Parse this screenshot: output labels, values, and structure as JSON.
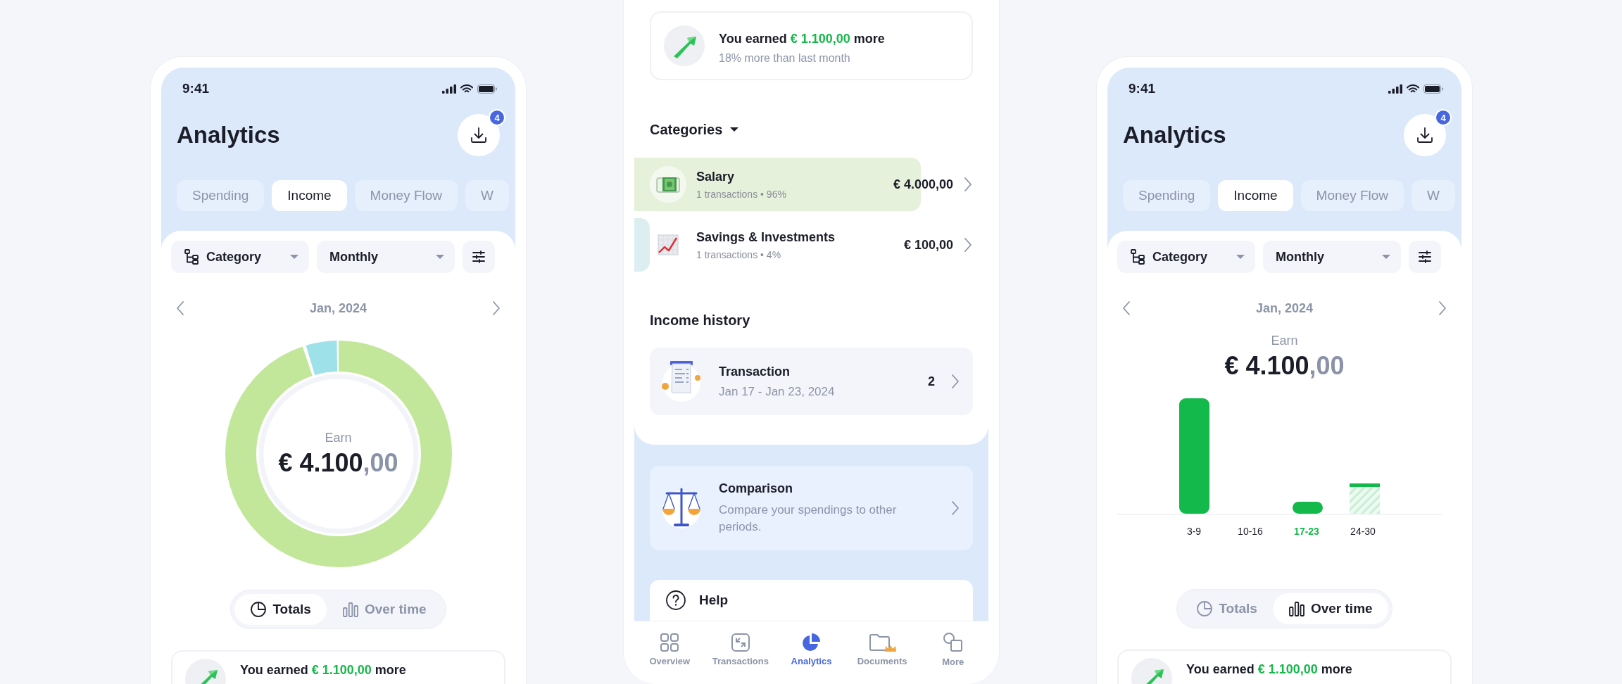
{
  "screens": [
    {
      "kind": "totals",
      "status_bar": {
        "time": "9:41"
      },
      "title": "Analytics",
      "download_badge": "4",
      "tabs": [
        {
          "label": "Spending",
          "selected": false
        },
        {
          "label": "Income",
          "selected": true
        },
        {
          "label": "Money Flow",
          "selected": false
        },
        {
          "label": "W",
          "selected": false
        }
      ],
      "filters": {
        "group_by": "Category",
        "period": "Monthly"
      },
      "period": "Jan, 2024",
      "total": {
        "label": "Earn",
        "whole": "€ 4.100",
        "cents": ",00"
      },
      "view_toggle": [
        {
          "label": "Totals",
          "selected": true
        },
        {
          "label": "Over time",
          "selected": false
        }
      ],
      "insight": {
        "prefix": "You earned",
        "amount": "€ 1.100,00",
        "suffix": "more"
      }
    },
    {
      "kind": "details",
      "insight": {
        "prefix": "You earned",
        "amount": "€ 1.100,00",
        "suffix": "more",
        "subtitle": "18% more than last month"
      },
      "categories_title": "Categories",
      "categories": [
        {
          "name": "Salary",
          "meta": "1 transactions • 96%",
          "amount": "€ 4.000,00",
          "level": 0.81,
          "color": "#e6f1dc"
        },
        {
          "name": "Savings & Investments",
          "meta": "1 transactions • 4%",
          "amount": "€ 100,00",
          "level": 0.044,
          "color": "#ddeef1"
        }
      ],
      "history_title": "Income history",
      "history": [
        {
          "title": "Transaction",
          "dates": "Jan 17 - Jan 23, 2024",
          "count": "2"
        }
      ],
      "comparison": {
        "title": "Comparison",
        "text": "Compare your spendings to other periods."
      },
      "help": {
        "label": "Help"
      },
      "nav": [
        {
          "label": "Overview",
          "selected": false
        },
        {
          "label": "Transactions",
          "selected": false
        },
        {
          "label": "Analytics",
          "selected": true
        },
        {
          "label": "Documents",
          "selected": false
        },
        {
          "label": "More",
          "selected": false
        }
      ]
    },
    {
      "kind": "over_time",
      "status_bar": {
        "time": "9:41"
      },
      "title": "Analytics",
      "download_badge": "4",
      "tabs": [
        {
          "label": "Spending",
          "selected": false
        },
        {
          "label": "Income",
          "selected": true
        },
        {
          "label": "Money Flow",
          "selected": false
        },
        {
          "label": "W",
          "selected": false
        }
      ],
      "filters": {
        "group_by": "Category",
        "period": "Monthly"
      },
      "period": "Jan, 2024",
      "total": {
        "label": "Earn",
        "whole": "€ 4.100",
        "cents": ",00"
      },
      "week_labels": [
        {
          "label": "3-9",
          "selected": false
        },
        {
          "label": "10-16",
          "selected": false
        },
        {
          "label": "17-23",
          "selected": true
        },
        {
          "label": "24-30",
          "selected": false
        }
      ],
      "view_toggle": [
        {
          "label": "Totals",
          "selected": false
        },
        {
          "label": "Over time",
          "selected": true
        }
      ],
      "insight": {
        "prefix": "You earned",
        "amount": "€ 1.100,00",
        "suffix": "more"
      }
    }
  ]
}
